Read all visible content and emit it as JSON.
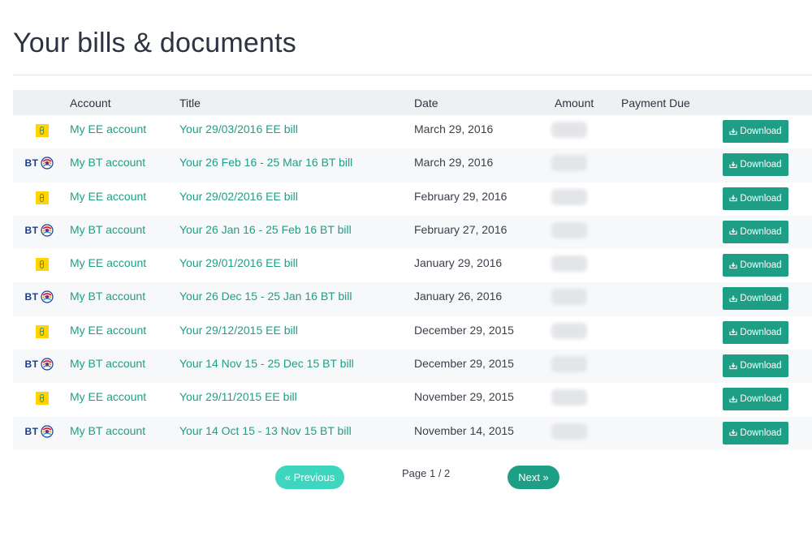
{
  "page": {
    "title": "Your bills & documents"
  },
  "table": {
    "headers": {
      "account": "Account",
      "title": "Title",
      "date": "Date",
      "amount": "Amount",
      "payment_due": "Payment Due"
    },
    "rows": [
      {
        "provider": "EE",
        "account": "My EE account",
        "title": "Your 29/03/2016 EE bill",
        "date": "March 29, 2016",
        "action": "Download"
      },
      {
        "provider": "BT",
        "account": "My BT account",
        "title": "Your 26 Feb 16 - 25 Mar 16 BT bill",
        "date": "March 29, 2016",
        "action": "Download"
      },
      {
        "provider": "EE",
        "account": "My EE account",
        "title": "Your 29/02/2016 EE bill",
        "date": "February 29, 2016",
        "action": "Download"
      },
      {
        "provider": "BT",
        "account": "My BT account",
        "title": "Your 26 Jan 16 - 25 Feb 16 BT bill",
        "date": "February 27, 2016",
        "action": "Download"
      },
      {
        "provider": "EE",
        "account": "My EE account",
        "title": "Your 29/01/2016 EE bill",
        "date": "January 29, 2016",
        "action": "Download"
      },
      {
        "provider": "BT",
        "account": "My BT account",
        "title": "Your 26 Dec 15 - 25 Jan 16 BT bill",
        "date": "January 26, 2016",
        "action": "Download"
      },
      {
        "provider": "EE",
        "account": "My EE account",
        "title": "Your 29/12/2015 EE bill",
        "date": "December 29, 2015",
        "action": "Download"
      },
      {
        "provider": "BT",
        "account": "My BT account",
        "title": "Your 14 Nov 15 - 25 Dec 15 BT bill",
        "date": "December 29, 2015",
        "action": "Download"
      },
      {
        "provider": "EE",
        "account": "My EE account",
        "title": "Your 29/11/2015 EE bill",
        "date": "November 29, 2015",
        "action": "Download"
      },
      {
        "provider": "BT",
        "account": "My BT account",
        "title": "Your 14 Oct 15 - 13 Nov 15 BT bill",
        "date": "November 14, 2015",
        "action": "Download"
      }
    ]
  },
  "logos": {
    "bt_text": "BT"
  },
  "icons": {
    "download": "download-icon",
    "ee": "ee-logo-icon",
    "bt": "bt-logo-icon"
  },
  "pagination": {
    "previous": "« Previous",
    "indicator": "Page 1 / 2",
    "next": "Next »"
  },
  "colors": {
    "accent": "#1f9e86",
    "accent_light": "#3fd6bf",
    "ee_yellow": "#ffd400",
    "bt_blue": "#1b3c8c"
  }
}
